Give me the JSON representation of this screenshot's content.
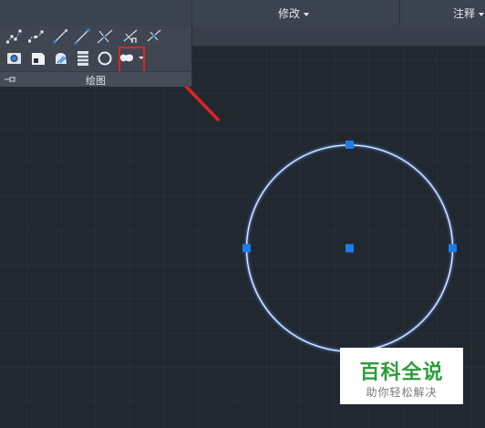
{
  "ribbon": {
    "tabs": [
      {
        "label": "修改"
      },
      {
        "label": "注释"
      }
    ]
  },
  "draw_panel": {
    "title": "绘图",
    "tools_row1": [
      "multipoint-icon",
      "spline-icon",
      "ray-icon",
      "line-icon",
      "construction-line-icon",
      "highlighted-tool-icon",
      "construction-line-icon"
    ],
    "tools_row2": [
      "region-icon",
      "table-icon",
      "hatch-icon",
      "gradient-icon",
      "circle-icon",
      "boundary-icon"
    ]
  },
  "colors": {
    "canvas": "#212830",
    "grid": "#2c343e",
    "circle_stroke": "#dbe9ff",
    "grip": "#1e7ce6",
    "highlight_box": "#e12323",
    "arrow": "#e12323"
  },
  "watermark": {
    "main": "百科全说",
    "sub": "助你轻松解决"
  }
}
